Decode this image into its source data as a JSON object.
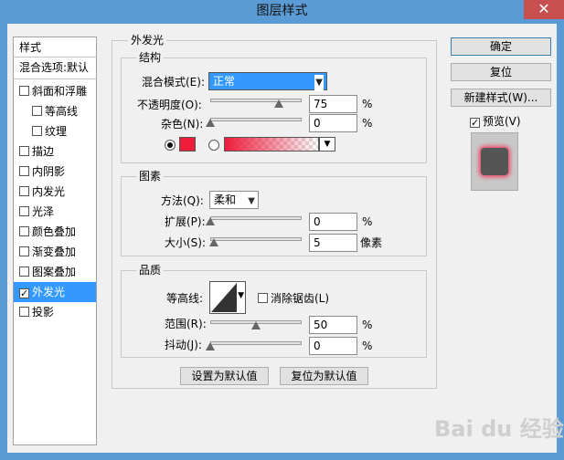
{
  "window": {
    "title": "图层样式",
    "close": "✕"
  },
  "sidebar": {
    "header": "样式",
    "blend_options": "混合选项:默认",
    "items": [
      {
        "label": "斜面和浮雕",
        "checked": false,
        "indent": false
      },
      {
        "label": "等高线",
        "checked": false,
        "indent": true
      },
      {
        "label": "纹理",
        "checked": false,
        "indent": true
      },
      {
        "label": "描边",
        "checked": false,
        "indent": false
      },
      {
        "label": "内阴影",
        "checked": false,
        "indent": false
      },
      {
        "label": "内发光",
        "checked": false,
        "indent": false
      },
      {
        "label": "光泽",
        "checked": false,
        "indent": false
      },
      {
        "label": "颜色叠加",
        "checked": false,
        "indent": false
      },
      {
        "label": "渐变叠加",
        "checked": false,
        "indent": false
      },
      {
        "label": "图案叠加",
        "checked": false,
        "indent": false
      },
      {
        "label": "外发光",
        "checked": true,
        "indent": false,
        "selected": true
      },
      {
        "label": "投影",
        "checked": false,
        "indent": false
      }
    ],
    "check_mark": "✓"
  },
  "panel": {
    "title": "外发光",
    "structure": {
      "title": "结构",
      "blend_mode_label": "混合模式(E):",
      "blend_mode_value": "正常",
      "opacity_label": "不透明度(O):",
      "opacity_value": "75",
      "opacity_fraction": 0.75,
      "noise_label": "杂色(N):",
      "noise_value": "0",
      "noise_fraction": 0,
      "percent": "%",
      "glow_color": "#ee1c3a"
    },
    "elements": {
      "title": "图素",
      "method_label": "方法(Q):",
      "method_value": "柔和",
      "spread_label": "扩展(P):",
      "spread_value": "0",
      "spread_fraction": 0,
      "size_label": "大小(S):",
      "size_value": "5",
      "size_fraction": 0.02,
      "percent": "%",
      "pixel_unit": "像素"
    },
    "quality": {
      "title": "品质",
      "contour_label": "等高线:",
      "antialias_label": "消除锯齿(L)",
      "range_label": "范围(R):",
      "range_value": "50",
      "range_fraction": 0.5,
      "jitter_label": "抖动(J):",
      "jitter_value": "0",
      "jitter_fraction": 0,
      "percent": "%"
    },
    "set_default": "设置为默认值",
    "reset_default": "复位为默认值"
  },
  "buttons": {
    "ok": "确定",
    "reset": "复位",
    "new_style": "新建样式(W)...",
    "preview_label": "预览(V)",
    "preview_checked": true
  },
  "watermark": "Bai du 经验"
}
